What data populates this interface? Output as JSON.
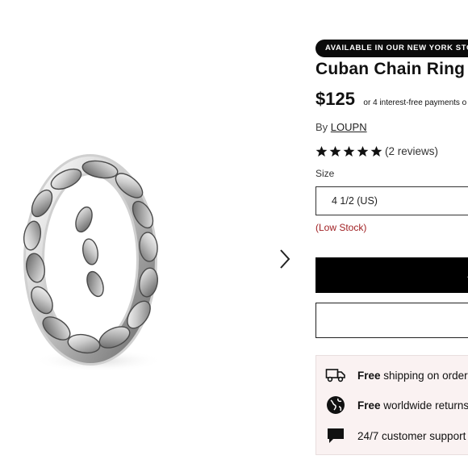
{
  "badge": "AVAILABLE IN OUR NEW YORK STOR",
  "product": {
    "title": "Cuban Chain Ring",
    "price": "$125",
    "installment_text": "or 4 interest-free payments o",
    "by_label": "By",
    "brand": "LOUPN",
    "rating": 5,
    "reviews_text": "(2 reviews)"
  },
  "size": {
    "label": "Size",
    "selected": "4 1/2 (US)",
    "stock_text": "(Low Stock)"
  },
  "buttons": {
    "add_label": "A"
  },
  "perks": [
    {
      "icon": "truck-icon",
      "bold": "Free",
      "text": "shipping on orders"
    },
    {
      "icon": "globe-icon",
      "bold": "Free",
      "text": "worldwide returns"
    },
    {
      "icon": "chat-bubble-icon",
      "bold": "",
      "text": "24/7 customer support"
    }
  ],
  "colors": {
    "badge_bg": "#0b0b0b",
    "stock": "#a01f22",
    "perks_bg": "#faf2f2"
  },
  "icons": {
    "next": "chevron-right-icon",
    "star": "star-icon"
  }
}
